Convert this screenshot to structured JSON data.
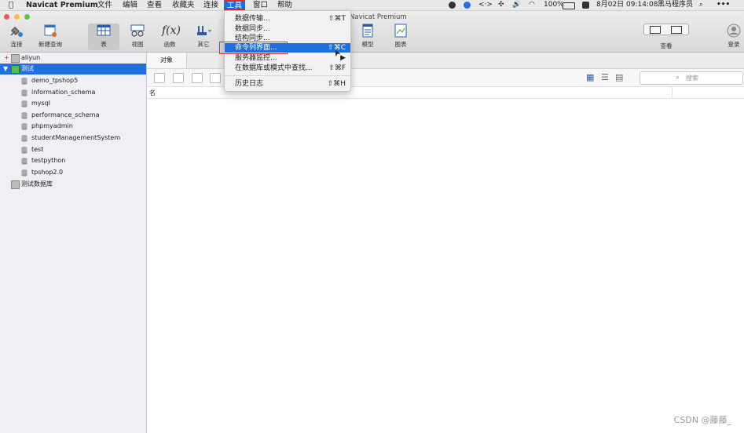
{
  "menubar": {
    "app_name": "Navicat Premium",
    "menus": [
      "文件",
      "编辑",
      "查看",
      "收藏夹",
      "连接",
      "工具",
      "窗口",
      "帮助"
    ],
    "status": {
      "battery": "100%",
      "datetime": "8月02日 09:14:08",
      "user": "黑马程序员"
    }
  },
  "window": {
    "title": "Navicat Premium"
  },
  "toolbar": {
    "connect": "连接",
    "new_query": "新建查询",
    "table": "表",
    "view": "视图",
    "function": "函数",
    "other": "其它",
    "model": "模型",
    "chart": "图表",
    "view_mode": "查看",
    "login": "登录"
  },
  "sidebar": {
    "connection1": "aliyun",
    "connection2": "测试",
    "databases": [
      "demo_tpshop5",
      "information_schema",
      "mysql",
      "performance_schema",
      "phpmyadmin",
      "studentManagementSystem",
      "test",
      "testpython",
      "tpshop2.0"
    ],
    "connection3": "测试数据库"
  },
  "main": {
    "tab": "对象",
    "search_placeholder": "搜索",
    "column_name": "名"
  },
  "dropdown": {
    "items": [
      {
        "label": "数据传输...",
        "shortcut": "⇧⌘T"
      },
      {
        "label": "数据同步...",
        "shortcut": ""
      },
      {
        "label": "结构同步...",
        "shortcut": ""
      },
      {
        "label": "命令列界面...",
        "shortcut": "⇧⌘C"
      },
      {
        "label": "服务器监控...",
        "shortcut": "▶"
      },
      {
        "label": "在数据库或模式中查找...",
        "shortcut": "⇧⌘F"
      },
      {
        "label": "历史日志",
        "shortcut": "⇧⌘H"
      }
    ]
  },
  "watermark": "CSDN @藤藤_",
  "colors": {
    "accent": "#1f6fe0",
    "highlight_border": "#d62d2d"
  }
}
